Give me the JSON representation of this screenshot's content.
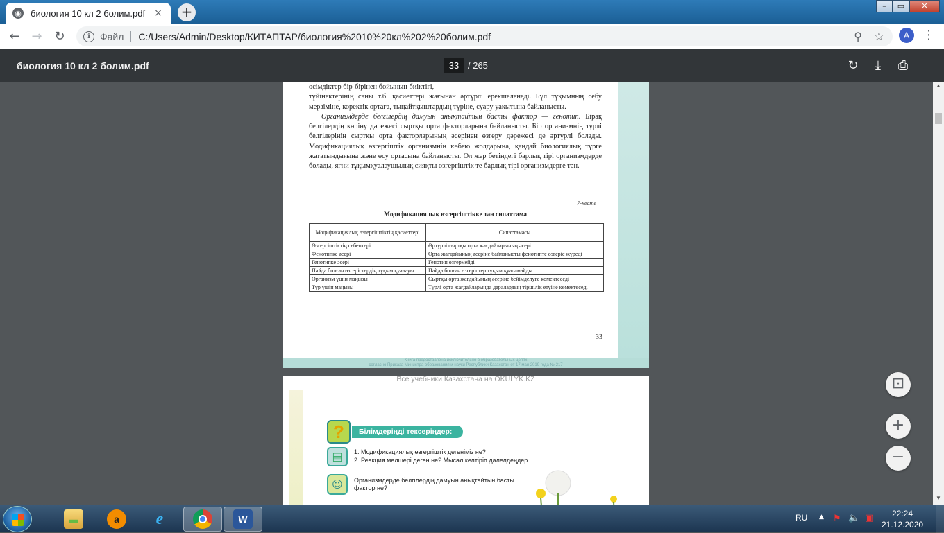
{
  "browser": {
    "tab_title": "биология 10 кл 2 болим.pdf",
    "tab_favicon": "document-icon",
    "new_tab_label": "+",
    "close_label": "×",
    "window_controls": {
      "minimize": "–",
      "maximize": "▭",
      "close": "✕"
    },
    "address": {
      "scheme_label": "Файл",
      "url": "C:/Users/Admin/Desktop/КИТАПТАР/биология%2010%20кл%202%20болим.pdf"
    },
    "profile_initial": "A"
  },
  "pdf_toolbar": {
    "title": "биология 10 кл 2 болим.pdf",
    "current_page": "33",
    "total_pages": "/ 265"
  },
  "page1": {
    "paragraphs": [
      "өсімдіктер бір-бірінен бойының биіктігі,",
      "түйінектерінің саны т.б. қасиеттері жағынан әртүрлі ерекшеленеді. Бұл тұқымның себу мерзіміне, коректік ортаға, тыңайтқыштардың түріне, суару уақытына байланысты."
    ],
    "italic_lead": "Организмдерде белгілердің дамуын анықтайтын басты фактор — генотип",
    "paragraph3_rest": ". Бірақ белгілердің көріну дәрежесі сыртқы орта факторларына байланысты. Бір организмнің түрлі белгілерінің сыртқы орта факторларының әсерінен өзгеру дәрежесі де әртүрлі болады. Модификациялық өзгергіштік организмнің көбею жолдарына, қандай биологиялық түрге жататындығына және өсу ортасына байланысты. Ол жер бетіндегі барлық тірі организмдерде болады, яғни тұқымқуалаушылық сияқты өзгергіштік те барлық тірі организмдерге тән.",
    "table_note": "7-кесте",
    "table_title": "Модификациялық өзгергіштікке тән сипаттама",
    "table_headers": [
      "Модификациялық өзгергіштіктің қасиеттері",
      "Сипаттамасы"
    ],
    "table_rows": [
      [
        "Өзгергіштіктің себептері",
        "Әртүрлі сыртқы орта жағдайларының әсері"
      ],
      [
        "Фенотипке әсері",
        "Орта жағдайының әсеріне байланысты фенотипте өзгеріс жүреді"
      ],
      [
        "Генотипке әсері",
        "Генотип өзгермейді"
      ],
      [
        "Пайда болған өзгерістердің тұқым қуалауы",
        "Пайда болған өзгерістер тұқым қуаламайды"
      ],
      [
        "Организм үшін маңызы",
        "Сыртқы орта жағдайының әсеріне бейімделуге көмектеседі"
      ],
      [
        "Түр үшін маңызы",
        "Түрлі орта жағдайларында даралардың тіршілік етуіне көмектеседі"
      ]
    ],
    "page_number": "33",
    "footer_line1": "Книга предоставлена исключительно в образовательных целях",
    "footer_line2": "согласно Приказа Министра образования и науки Республики Казахстан от 17 мая 2019 года № 217"
  },
  "page2": {
    "watermark": "Все учебники Казахстана на OKULYK.KZ",
    "banner": "Білімдеріңді тексеріңдер:",
    "question_mark": "?",
    "q1": "1. Модификациялық өзгергіштік дегеніміз не?",
    "q2": "2. Реакция мөлшері деген не? Мысал келтіріп дәлелдеңдер.",
    "q3": "Организмдерде белгілердің дамуын анықтайтын басты фактор не?"
  },
  "zoom": {
    "fit": "⊡",
    "in": "+",
    "out": "−"
  },
  "taskbar": {
    "language": "RU",
    "time": "22:24",
    "date": "21.12.2020",
    "apps": [
      "file-explorer",
      "avast",
      "internet-explorer",
      "chrome",
      "word"
    ],
    "word_label": "W",
    "avast_label": "a",
    "ie_label": "e"
  }
}
